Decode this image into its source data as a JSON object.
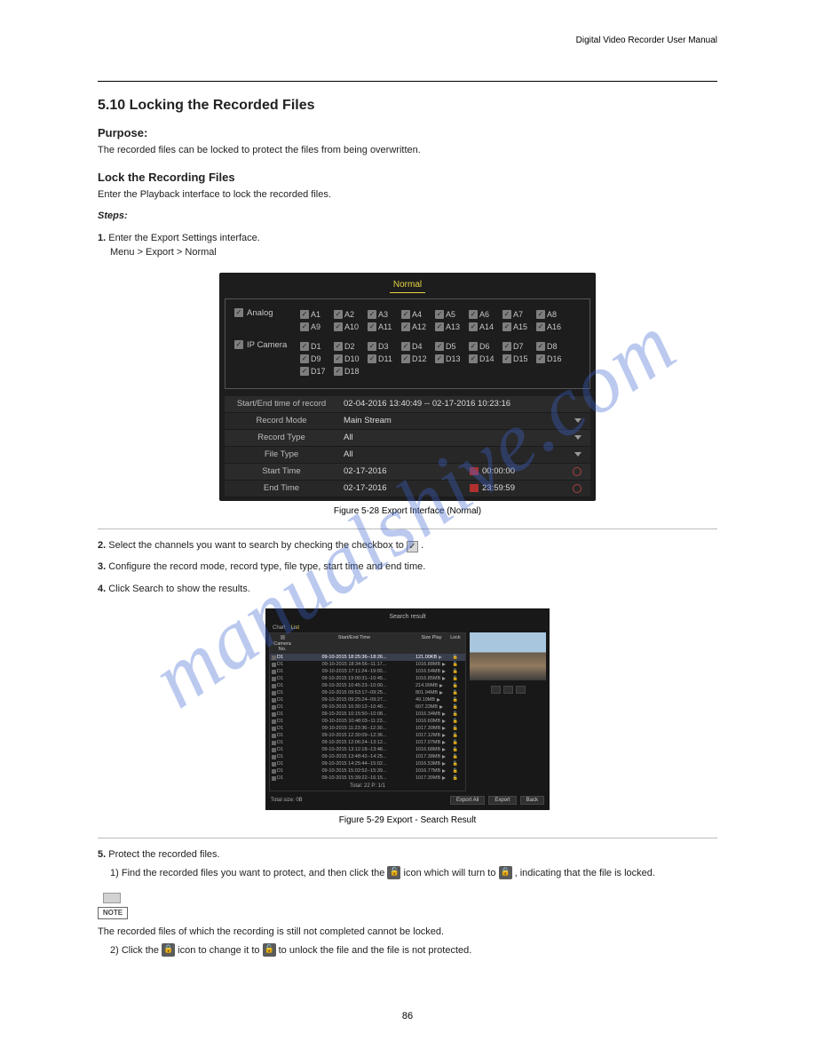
{
  "doc_header": "Digital Video Recorder User Manual",
  "page_number": "86",
  "heading": "5.10 Locking the Recorded Files",
  "purpose_label": "Purpose:",
  "purpose_text": "The recorded files can be locked to protect the files from being overwritten.",
  "sub_heading": "Lock the Recording Files",
  "sub_text": "Enter the Playback interface to lock the recorded files.",
  "steps_label": "Steps:",
  "step1": "Enter the Export Settings interface.",
  "menu_path": "Menu > Export > Normal",
  "dvr": {
    "tab": "Normal",
    "analog_label": "Analog",
    "ip_label": "IP Camera",
    "analog": [
      "A1",
      "A2",
      "A3",
      "A4",
      "A5",
      "A6",
      "A7",
      "A8",
      "A9",
      "A10",
      "A11",
      "A12",
      "A13",
      "A14",
      "A15",
      "A16"
    ],
    "ipcam": [
      "D1",
      "D2",
      "D3",
      "D4",
      "D5",
      "D6",
      "D7",
      "D8",
      "D9",
      "D10",
      "D11",
      "D12",
      "D13",
      "D14",
      "D15",
      "D16",
      "D17",
      "D18"
    ],
    "fields": {
      "rec_range_label": "Start/End time of record",
      "rec_range_value": "02-04-2016 13:40:49 -- 02-17-2016 10:23:16",
      "mode_label": "Record Mode",
      "mode_value": "Main Stream",
      "rtype_label": "Record Type",
      "rtype_value": "All",
      "ftype_label": "File Type",
      "ftype_value": "All",
      "start_label": "Start Time",
      "start_date": "02-17-2016",
      "start_time": "00:00:00",
      "end_label": "End Time",
      "end_date": "02-17-2016",
      "end_time": "23:59:59"
    }
  },
  "fig1_caption": "Figure 5-28 Export Interface (Normal)",
  "step2_a": "Select the channels you want to search by checking the checkbox to ",
  "step2_b": ".",
  "step3": "Configure the record mode, record type, file type, start time and end time.",
  "step4": "Click Search to show the results.",
  "search": {
    "title": "Search result",
    "tabs_chart": "Chart",
    "tabs_list": "List",
    "col_cam": "Camera No.",
    "col_time": "Start/End Time",
    "col_size": "Size Play",
    "col_lock": "Lock",
    "rows": [
      {
        "cam": "D1",
        "time": "09-10-2015 18:25:36--18:26...",
        "size": "121.00KB",
        "hl": true
      },
      {
        "cam": "D1",
        "time": "09-10-2015 18:34:56--11:17...",
        "size": "1016.88MB"
      },
      {
        "cam": "D1",
        "time": "09-10-2015 17:11:24--19:00...",
        "size": "1016.54MB"
      },
      {
        "cam": "D1",
        "time": "09-10-2015 19:00:31--10:45...",
        "size": "1016.85MB"
      },
      {
        "cam": "D1",
        "time": "09-10-2015 10:45:23--10:00...",
        "size": "214.99MB"
      },
      {
        "cam": "D1",
        "time": "09-10-2015 09:53:17--09:25...",
        "size": "801.94MB"
      },
      {
        "cam": "D1",
        "time": "09-10-2015 09:25:24--09:27...",
        "size": "49.19MB"
      },
      {
        "cam": "D1",
        "time": "09-10-2015 10:30:12--10:40...",
        "size": "607.23MB"
      },
      {
        "cam": "D1",
        "time": "09-10-2015 10:15:50--10:08...",
        "size": "1016.34MB"
      },
      {
        "cam": "D1",
        "time": "09-10-2015 10:48:03--11:23...",
        "size": "1016.60MB"
      },
      {
        "cam": "D1",
        "time": "09-10-2015 11:23:36--12:30...",
        "size": "1017.30MB"
      },
      {
        "cam": "D1",
        "time": "09-10-2015 12:30:09--12:36...",
        "size": "1017.12MB"
      },
      {
        "cam": "D1",
        "time": "09-10-2015 12:06:24--13:12...",
        "size": "1017.07MB"
      },
      {
        "cam": "D1",
        "time": "09-10-2015 13:12:18--13:48...",
        "size": "1016.68MB"
      },
      {
        "cam": "D1",
        "time": "09-10-2015 13:48:42--14:25...",
        "size": "1017.38MB"
      },
      {
        "cam": "D1",
        "time": "09-10-2015 14:25:44--15:02...",
        "size": "1016.53MB"
      },
      {
        "cam": "D1",
        "time": "09-10-2015 15:02:52--15:39...",
        "size": "1016.77MB"
      },
      {
        "cam": "D1",
        "time": "09-10-2015 15:39:22--16:15...",
        "size": "1017.30MB"
      }
    ],
    "count": "Total: 22  P: 1/1",
    "total_size": "Total size: 0B",
    "btn_export_all": "Export All",
    "btn_export": "Export",
    "btn_back": "Back"
  },
  "fig2_caption": "Figure 5-29 Export - Search Result",
  "step5_a": "Protect the recorded files.",
  "step5_b": "Find the recorded files you want to protect, and then click the ",
  "step5_c": " icon which will turn to ",
  "step5_d": ", indicating that the file is locked.",
  "note_box_label": "NOTE",
  "note1": "The recorded files of which the recording is still not completed cannot be locked.",
  "note2_a": "Click the ",
  "note2_b": " icon to change it to ",
  "note2_c": " to unlock the file and the file is not protected.",
  "watermark": "manualshive.com"
}
